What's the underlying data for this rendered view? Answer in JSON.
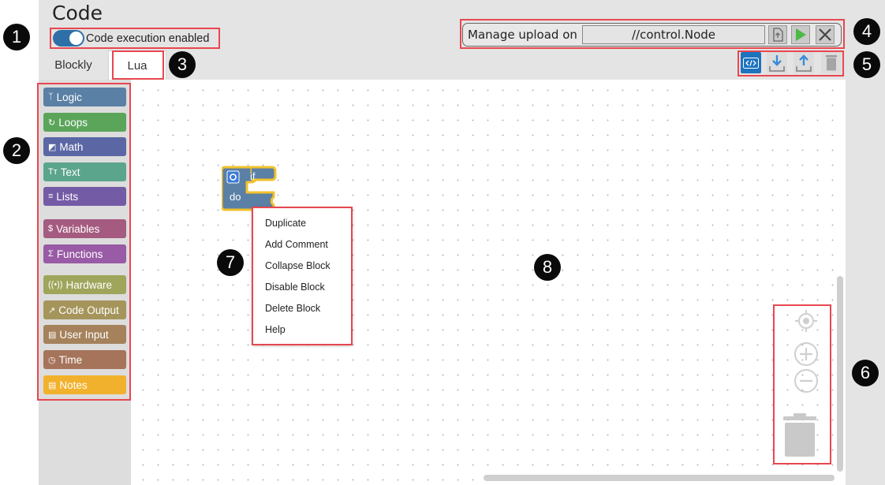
{
  "app": {
    "title": "Code"
  },
  "toggle": {
    "label": "Code execution enabled",
    "state": "on",
    "color": "#2e6fa8"
  },
  "upload": {
    "label": "Manage upload on",
    "path": "//control.Node"
  },
  "tabs": [
    {
      "label": "Blockly"
    },
    {
      "label": "Lua"
    }
  ],
  "toolbar_icons": [
    "code-view-icon",
    "download-icon",
    "upload-icon",
    "trash-icon"
  ],
  "toolbox": {
    "categories": [
      {
        "label": "Logic",
        "icon": "ᛉ",
        "color": "#5b80a5"
      },
      {
        "label": "Loops",
        "icon": "↻",
        "color": "#5ba55b"
      },
      {
        "label": "Math",
        "icon": "◩",
        "color": "#5b67a5"
      },
      {
        "label": "Text",
        "icon": "Tт",
        "color": "#5ba58c"
      },
      {
        "label": "Lists",
        "icon": "≡",
        "color": "#745ba5"
      },
      {
        "label": "Variables",
        "icon": "$",
        "color": "#a55b80"
      },
      {
        "label": "Functions",
        "icon": "Σ",
        "color": "#995ba5"
      },
      {
        "label": "Hardware",
        "icon": "((•))",
        "color": "#9fa55b"
      },
      {
        "label": "Code Output",
        "icon": "↗",
        "color": "#a5955b"
      },
      {
        "label": "User Input",
        "icon": "▤",
        "color": "#a5825b"
      },
      {
        "label": "Time",
        "icon": "◷",
        "color": "#a5745b"
      },
      {
        "label": "Notes",
        "icon": "▤",
        "color": "#f2b12c"
      }
    ]
  },
  "block": {
    "if_label": "if",
    "do_label": "do",
    "color": "#5b80a5",
    "highlight": "#f2c22c"
  },
  "context_menu": {
    "items": [
      "Duplicate",
      "Add Comment",
      "Collapse Block",
      "Disable Block",
      "Delete Block",
      "Help"
    ]
  },
  "badges": [
    "1",
    "2",
    "3",
    "4",
    "5",
    "6",
    "7",
    "8"
  ],
  "colors": {
    "highlight": "#e8474f",
    "badge": "#0a0a0a",
    "primary": "#2e6fa8"
  }
}
